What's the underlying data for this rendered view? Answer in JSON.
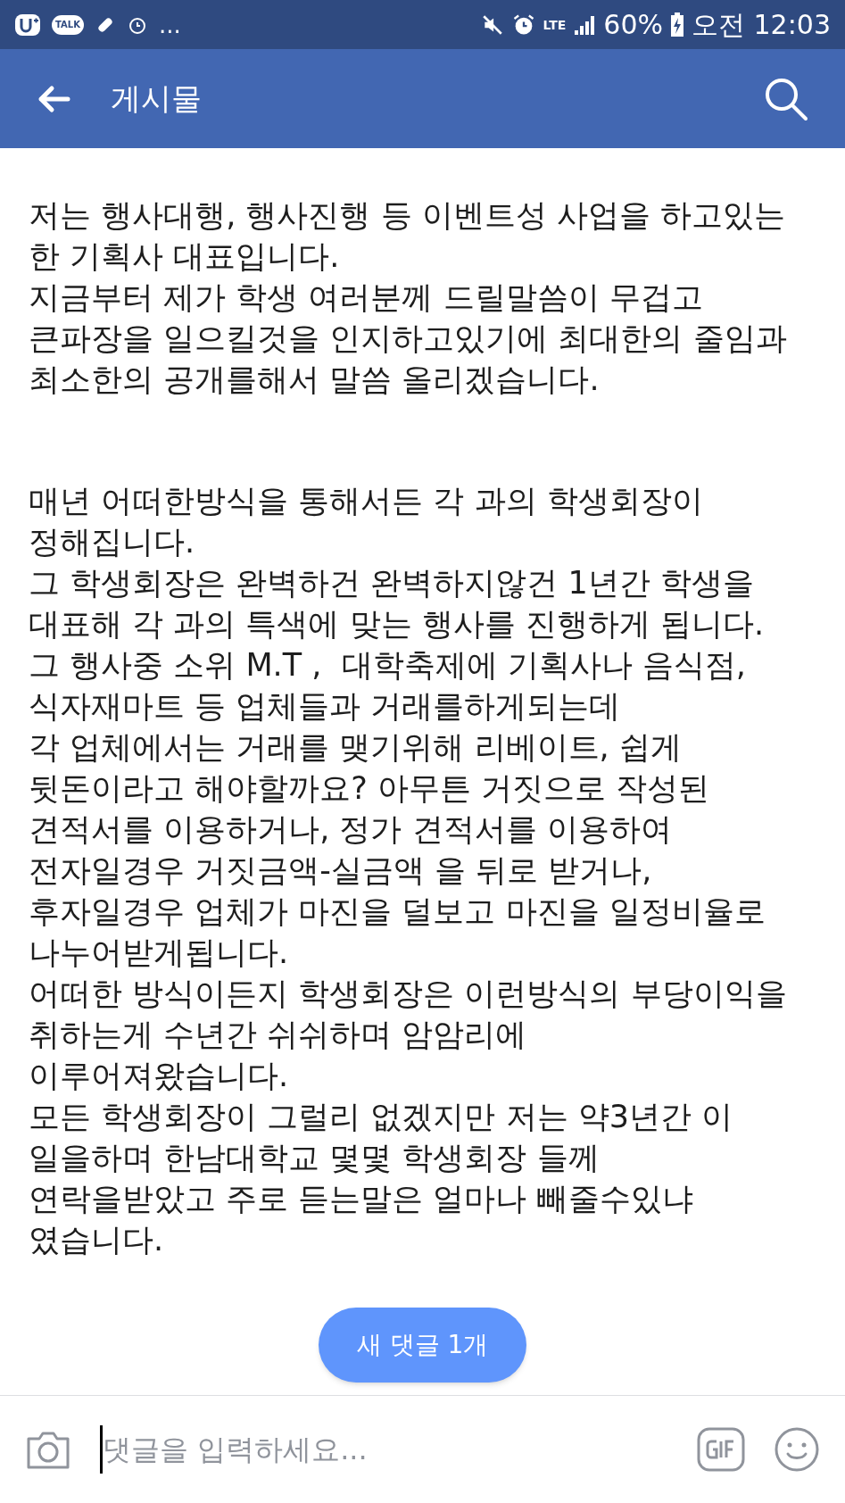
{
  "status_bar": {
    "notification_badge": "TALK",
    "more": "...",
    "network": "LTE",
    "battery": "60%",
    "time": "오전 12:03"
  },
  "header": {
    "title": "게시물"
  },
  "post": {
    "paragraphs": [
      [
        "저는 행사대행, 행사진행 등 이벤트성 사업을 하고있는",
        "한 기획사 대표입니다.",
        "지금부터 제가 학생 여러분께 드릴말씀이 무겁고",
        "큰파장을 일으킬것을 인지하고있기에 최대한의 줄임과",
        "최소한의 공개를해서 말씀 올리겠습니다."
      ],
      [
        "매년 어떠한방식을 통해서든 각 과의 학생회장이",
        "정해집니다.",
        "그 학생회장은 완벽하건 완벽하지않건 1년간 학생을",
        "대표해 각 과의 특색에 맞는 행사를 진행하게 됩니다.",
        "그 행사중 소위 M.T ,  대학축제에 기획사나 음식점,",
        "식자재마트 등 업체들과 거래를하게되는데",
        "각 업체에서는 거래를 맺기위해 리베이트, 쉽게",
        "뒷돈이라고 해야할까요? 아무튼 거짓으로 작성된",
        "견적서를 이용하거나, 정가 견적서를 이용하여",
        "전자일경우 거짓금액-실금액 을 뒤로 받거나,",
        "후자일경우 업체가 마진을 덜보고 마진을 일정비율로",
        "나누어받게됩니다.",
        "어떠한 방식이든지 학생회장은 이런방식의 부당이익을",
        "취하는게 수년간 쉬쉬하며 암암리에",
        "이루어져왔습니다.",
        "모든 학생회장이 그럴리 없겠지만 저는 약3년간 이",
        "일을하며 한남대학교 몇몇 학생회장 들께",
        "연락을받았고 주로 듣는말은 얼마나 빼줄수있냐",
        "였습니다."
      ]
    ]
  },
  "new_comments_button": "새 댓글 1개",
  "comment_bar": {
    "placeholder": "댓글을 입력하세요..."
  }
}
